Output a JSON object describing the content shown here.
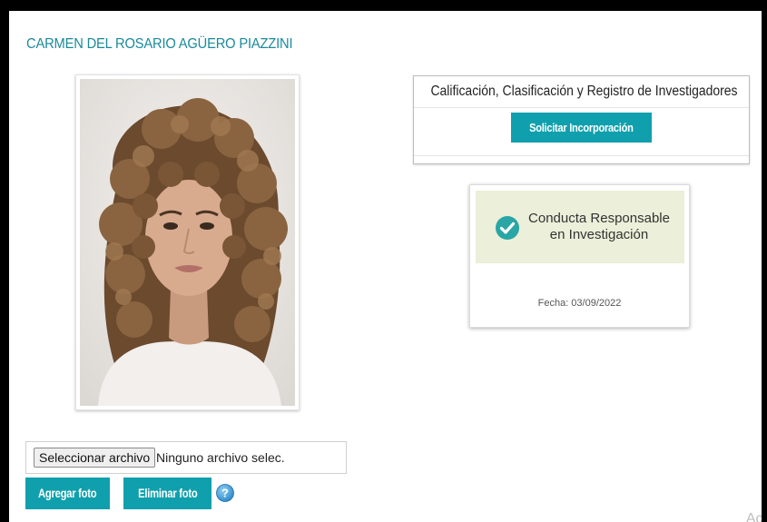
{
  "profile": {
    "name": "CARMEN DEL ROSARIO AGÜERO PIAZZINI"
  },
  "registry": {
    "title": "Calificación, Clasificación y Registro de Investigadores",
    "button_label": "Solicitar Incorporación"
  },
  "conduct_badge": {
    "title_line1": "Conducta Responsable",
    "title_line2": "en Investigación",
    "date_label": "Fecha: 03/09/2022",
    "icon": "check-circle-icon"
  },
  "photo_upload": {
    "select_button_label": "Seleccionar archivo",
    "file_status": "Ninguno archivo selec.",
    "add_button_label": "Agregar foto",
    "remove_button_label": "Eliminar foto",
    "help_icon": "question-circle-icon"
  },
  "footer": {
    "partial_text": "Act"
  },
  "colors": {
    "accent": "#10a0ad",
    "title_text": "#1a8a9a",
    "badge_background": "#ecefd9",
    "check_icon": "#29a6a6"
  }
}
